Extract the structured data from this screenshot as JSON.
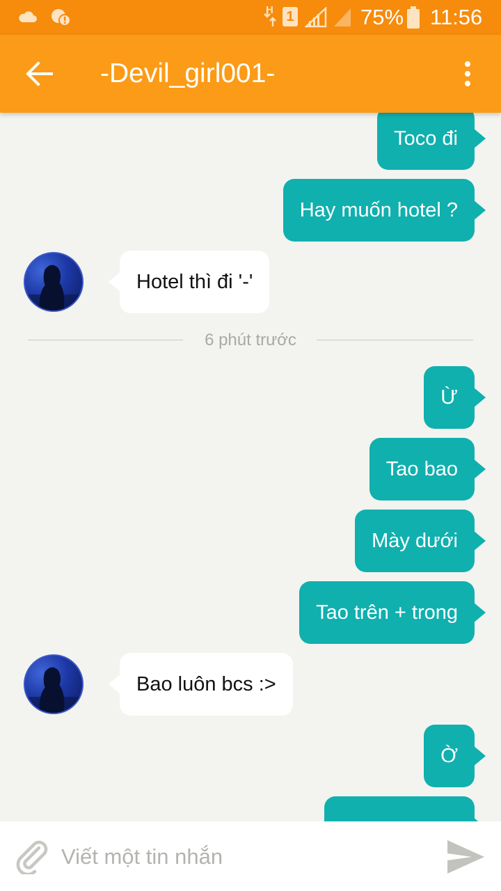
{
  "status_bar": {
    "battery": "75%",
    "time": "11:56",
    "network_type": "H",
    "sim_slot": "1",
    "icons": [
      "cloud-icon",
      "alert-message-icon",
      "data-arrows-icon",
      "signal-icon",
      "battery-icon"
    ]
  },
  "header": {
    "title": "-Devil_girl001-",
    "icons": [
      "back-arrow-icon",
      "more-vert-icon"
    ]
  },
  "messages": [
    {
      "direction": "out",
      "text": "Toco đi"
    },
    {
      "direction": "out",
      "text": "Hay muốn hotel ?"
    },
    {
      "direction": "in",
      "text": "Hotel thì đi '-'"
    },
    {
      "direction": "out",
      "text": "Ừ"
    },
    {
      "direction": "out",
      "text": "Tao bao"
    },
    {
      "direction": "out",
      "text": "Mày dưới"
    },
    {
      "direction": "out",
      "text": "Tao trên + trong"
    },
    {
      "direction": "in",
      "text": "Bao luôn bcs :>"
    },
    {
      "direction": "out",
      "text": "Ờ"
    }
  ],
  "time_divider": "6 phút trước",
  "compose": {
    "placeholder": "Viết một tin nhắn",
    "icons": [
      "attach-icon",
      "send-icon"
    ]
  },
  "colors": {
    "status_bar": "#f68b0c",
    "app_bar": "#fb9b17",
    "outgoing_bubble": "#10b0ae",
    "incoming_bubble": "#ffffff",
    "background": "#f3f4ef"
  }
}
